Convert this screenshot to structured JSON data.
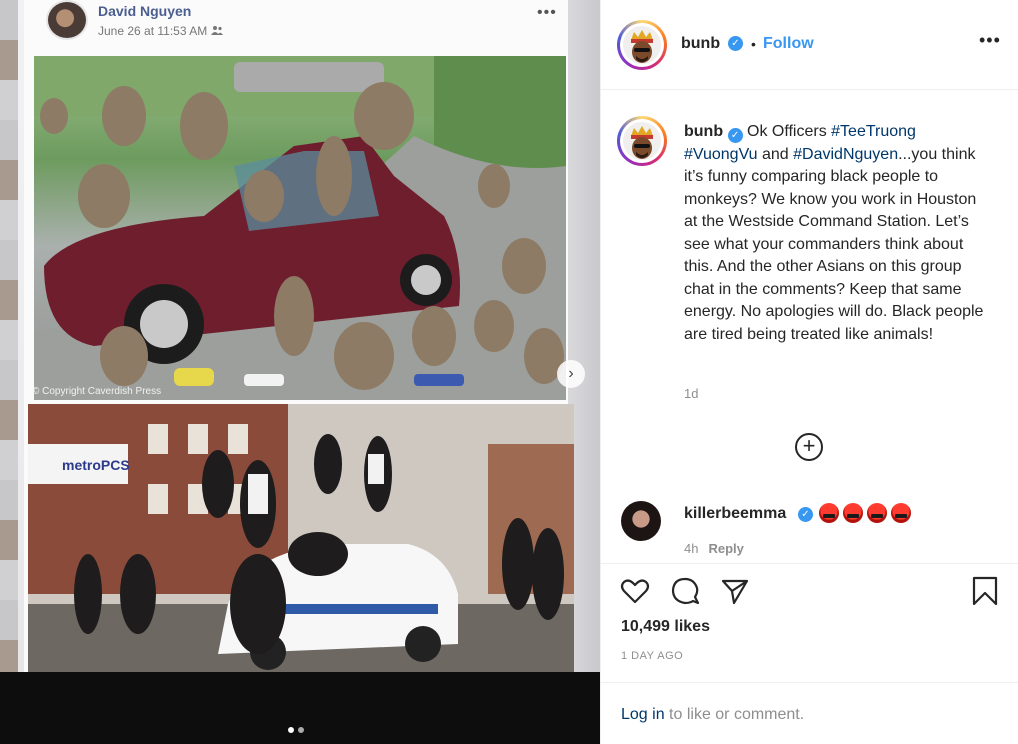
{
  "post_photo": {
    "facebook_post": {
      "author": "David Nguyen",
      "date": "June 26 at 11:53 AM",
      "audience_icon": "friends-icon",
      "more_icon": "more-horizontal-icon"
    },
    "image_top": {
      "description_icon": "photo-baboons-on-car",
      "watermark": "© Copyright Caverdish Press"
    },
    "image_bottom": {
      "description_icon": "photo-crowd-on-police-car",
      "store_sign": "metroPCS"
    },
    "carousel": {
      "next_icon": "chevron-right-icon",
      "total_slides": 2,
      "active_slide": 1
    }
  },
  "instagram": {
    "header": {
      "username": "bunb",
      "verified_icon": "verified-badge-icon",
      "separator": "•",
      "follow_label": "Follow",
      "more_icon": "more-horizontal-icon"
    },
    "caption": {
      "username": "bunb",
      "verified_icon": "verified-badge-icon",
      "text_1": " Ok Officers ",
      "tag_1": "#TeeTruong",
      "text_2": " ",
      "tag_2": "#VuongVu",
      "text_3": " and ",
      "tag_3": "#DavidNguyen",
      "text_4": "...you think it’s funny comparing black people to monkeys? We know you work in Houston at the Westside Command Station. Let’s see what your commanders think about this. And the other Asians on this group chat in the comments? Keep that same energy. No apologies will do. Black people are tired being treated like animals!",
      "time": "1d"
    },
    "load_more_icon": "plus-circle-icon",
    "comment": {
      "username": "killerbeemma",
      "verified_icon": "verified-badge-icon",
      "emoji_icons": [
        "angry-face-icon",
        "angry-face-icon",
        "angry-face-icon",
        "angry-face-icon"
      ],
      "time": "4h",
      "reply_label": "Reply"
    },
    "actions": {
      "like_icon": "heart-icon",
      "comment_icon": "comment-icon",
      "share_icon": "share-icon",
      "save_icon": "bookmark-icon"
    },
    "likes": "10,499 likes",
    "posted_ago": "1 DAY AGO",
    "footer": {
      "login_link": "Log in",
      "login_suffix": " to like or comment."
    }
  },
  "colors": {
    "link_blue": "#3897f0",
    "hashtag_navy": "#00376b",
    "muted_gray": "#8e8e8e",
    "text_dark": "#262626",
    "facebook_name": "#4a5e8f"
  }
}
